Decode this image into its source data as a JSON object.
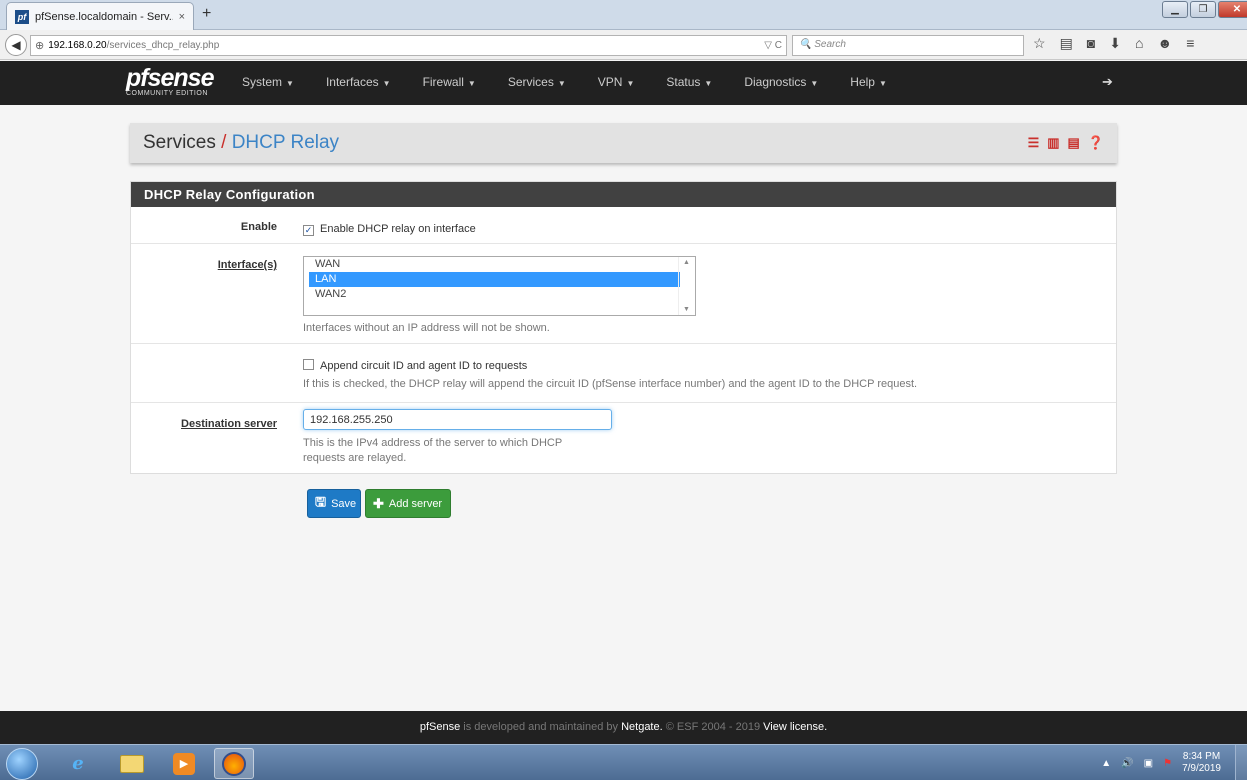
{
  "browser": {
    "tab_title": "pfSense.localdomain - Serv...",
    "tab_close": "×",
    "new_tab": "+",
    "url_host": "192.168.0.20",
    "url_path": "/services_dhcp_relay.php",
    "url_right": "▽ C",
    "search_placeholder": "Search"
  },
  "navbar": {
    "logo_main": "pfsense",
    "logo_sub": "COMMUNITY EDITION",
    "menu": [
      {
        "label": "System"
      },
      {
        "label": "Interfaces"
      },
      {
        "label": "Firewall"
      },
      {
        "label": "Services"
      },
      {
        "label": "VPN"
      },
      {
        "label": "Status"
      },
      {
        "label": "Diagnostics"
      },
      {
        "label": "Help"
      }
    ]
  },
  "breadcrumb": {
    "parent": "Services",
    "separator": "/",
    "current": "DHCP Relay"
  },
  "panel": {
    "heading": "DHCP Relay Configuration",
    "enable_label": "Enable",
    "enable_text": "Enable DHCP relay on interface",
    "enable_checked": true,
    "interfaces_label": "Interface(s)",
    "interfaces_options": [
      {
        "label": "WAN",
        "selected": false
      },
      {
        "label": "LAN",
        "selected": true
      },
      {
        "label": "WAN2",
        "selected": false
      }
    ],
    "interfaces_help": "Interfaces without an IP address will not be shown.",
    "append_text": "Append circuit ID and agent ID to requests",
    "append_checked": false,
    "append_help": "If this is checked, the DHCP relay will append the circuit ID (pfSense interface number) and the agent ID to the DHCP request.",
    "dest_label": "Destination server",
    "dest_value": "192.168.255.250",
    "dest_help_1": "This is the IPv4 address of the server to which DHCP",
    "dest_help_2": "requests are relayed."
  },
  "buttons": {
    "save": "Save",
    "add_server": "Add server"
  },
  "footer": {
    "brand": "pfSense",
    "text_1": " is developed and maintained by ",
    "company": "Netgate.",
    "text_2": " © ESF 2004 - 2019 ",
    "license": "View license."
  },
  "taskbar": {
    "time": "8:34 PM",
    "date": "7/9/2019"
  }
}
